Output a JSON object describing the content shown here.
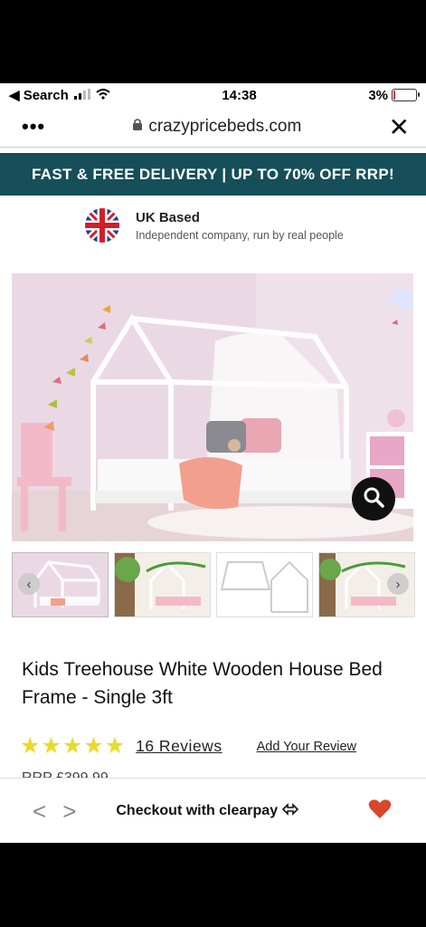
{
  "status": {
    "back_label": "Search",
    "time": "14:38",
    "battery": "3%"
  },
  "browser": {
    "url": "crazypricebeds.com",
    "menu_label": "•••",
    "close_label": "✕"
  },
  "banner": {
    "text": "FAST & FREE DELIVERY | UP TO 70% OFF RRP!"
  },
  "uk_based": {
    "title": "UK Based",
    "subtitle": "Independent company, run by real people"
  },
  "gallery": {
    "prev_label": "‹",
    "next_label": "›"
  },
  "product": {
    "title": "Kids Treehouse White Wooden House Bed Frame - Single 3ft",
    "rating": 5,
    "reviews_label": "16 Reviews",
    "add_review_label": "Add Your Review",
    "rrp_label": "RRP £399.99"
  },
  "bottom_bar": {
    "back_label": "<",
    "forward_label": ">",
    "checkout_label": "Checkout with clearpay"
  },
  "colors": {
    "banner": "#164f59",
    "stars": "#e7dc2a",
    "heart": "#d9472b"
  },
  "icons": [
    "wifi-icon",
    "battery-icon",
    "lock-icon",
    "close-icon",
    "uk-flag-icon",
    "search-icon",
    "heart-icon",
    "clearpay-icon"
  ]
}
